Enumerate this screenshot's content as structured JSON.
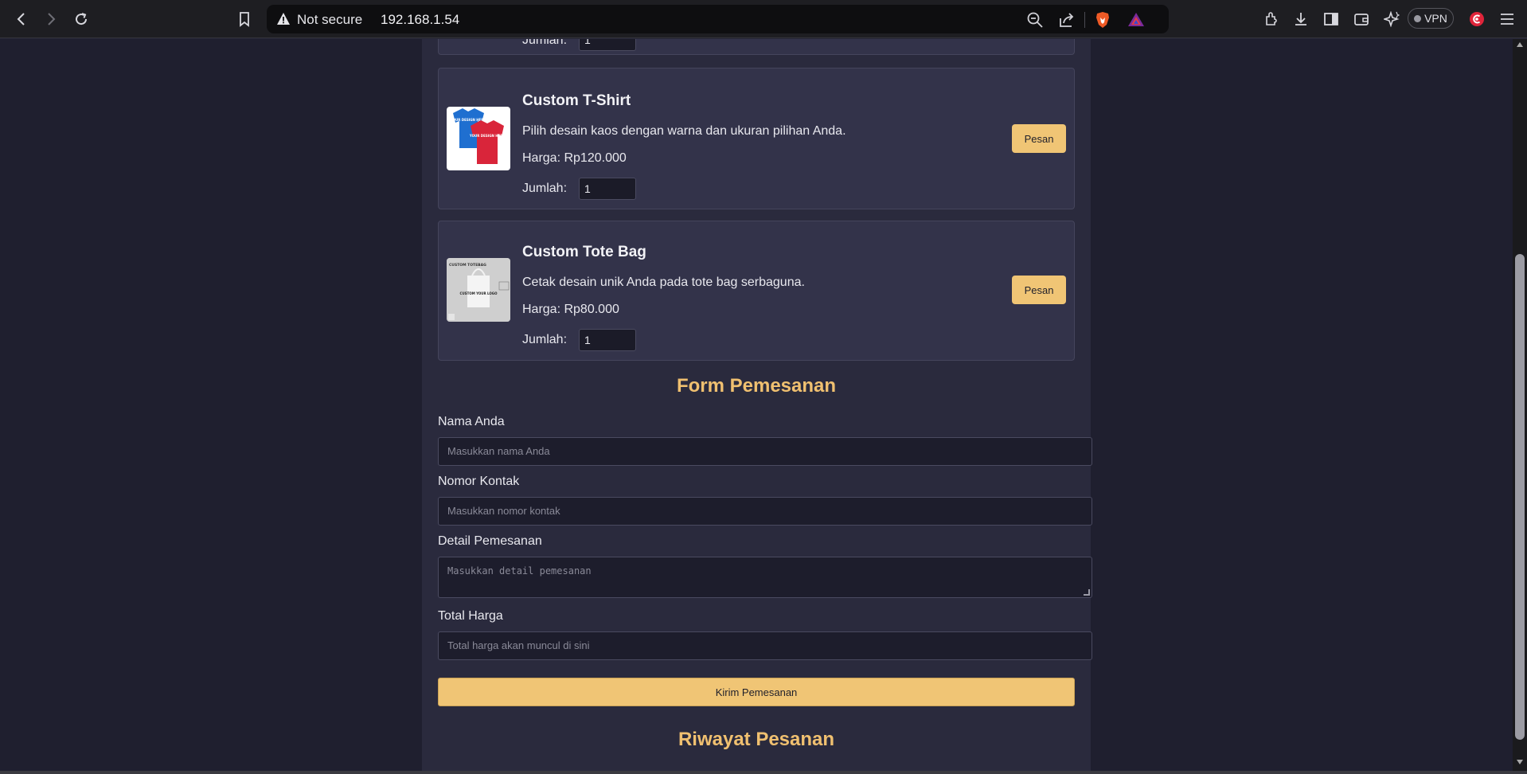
{
  "browser": {
    "security_label": "Not secure",
    "url": "192.168.1.54",
    "vpn_label": "VPN",
    "icons": [
      "back-icon",
      "forward-icon",
      "reload-icon",
      "bookmark-icon",
      "warning-icon",
      "zoom-icon",
      "share-icon",
      "brave-shield-icon",
      "brave-rewards-icon",
      "extensions-icon",
      "download-icon",
      "sidebar-icon",
      "wallet-icon",
      "leo-ai-icon",
      "profile-icon",
      "menu-icon"
    ]
  },
  "products": [
    {
      "title": "Custom T-Shirt",
      "description": "Pilih desain kaos dengan warna dan ukuran pilihan Anda.",
      "price": "Harga: Rp120.000",
      "qty_label": "Jumlah:",
      "qty_value": "1",
      "button": "Pesan",
      "image_text": [
        "YOUR DESIGN HERE",
        "YOUR DESIGN HERE"
      ]
    },
    {
      "title": "Custom Tote Bag",
      "description": "Cetak desain unik Anda pada tote bag serbaguna.",
      "price": "Harga: Rp80.000",
      "qty_label": "Jumlah:",
      "qty_value": "1",
      "button": "Pesan",
      "image_text": [
        "CUSTOM TOTEBAG",
        "CUSTOM YOUR LOGO"
      ]
    }
  ],
  "partial_top": {
    "qty_label": "Jumlah:",
    "qty_value": "1"
  },
  "form": {
    "title": "Form Pemesanan",
    "name_label": "Nama Anda",
    "name_placeholder": "Masukkan nama Anda",
    "contact_label": "Nomor Kontak",
    "contact_placeholder": "Masukkan nomor kontak",
    "detail_label": "Detail Pemesanan",
    "detail_placeholder": "Masukkan detail pemesanan",
    "total_label": "Total Harga",
    "total_placeholder": "Total harga akan muncul di sini",
    "submit": "Kirim Pemesanan"
  },
  "history": {
    "title": "Riwayat Pesanan"
  },
  "colors": {
    "accent": "#f0c575",
    "page_bg": "#1f1f2f",
    "container_bg": "#2a2a3d",
    "card_bg": "#33334a",
    "heading": "#f0c070"
  }
}
